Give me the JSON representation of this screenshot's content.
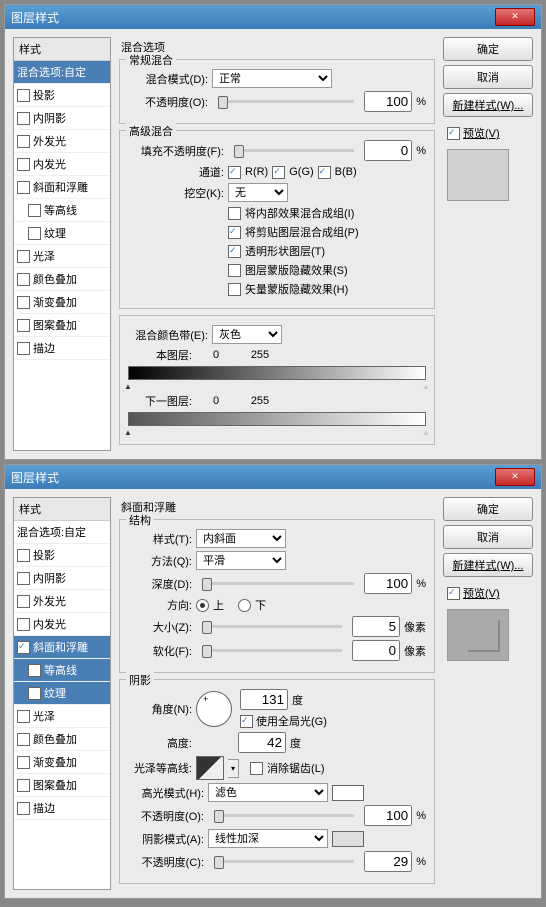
{
  "dialogs": [
    {
      "title": "图层样式",
      "styles_header": "样式",
      "styles": [
        {
          "label": "混合选项:自定",
          "chk": false,
          "sel": true
        },
        {
          "label": "投影",
          "chk": false
        },
        {
          "label": "内阴影",
          "chk": false
        },
        {
          "label": "外发光",
          "chk": false
        },
        {
          "label": "内发光",
          "chk": false
        },
        {
          "label": "斜面和浮雕",
          "chk": false
        },
        {
          "label": "等高线",
          "chk": false,
          "sub": true
        },
        {
          "label": "纹理",
          "chk": false,
          "sub": true
        },
        {
          "label": "光泽",
          "chk": false
        },
        {
          "label": "颜色叠加",
          "chk": false
        },
        {
          "label": "渐变叠加",
          "chk": false
        },
        {
          "label": "图案叠加",
          "chk": false
        },
        {
          "label": "描边",
          "chk": false
        }
      ],
      "section": "混合选项",
      "group1": "常规混合",
      "blend_mode_label": "混合模式(D):",
      "blend_mode": "正常",
      "opacity_label": "不透明度(O):",
      "opacity": "100",
      "pct": "%",
      "group2": "高级混合",
      "fill_label": "填充不透明度(F):",
      "fill": "0",
      "channels_label": "通道:",
      "ch_r": "R(R)",
      "ch_g": "G(G)",
      "ch_b": "B(B)",
      "knockout_label": "挖空(K):",
      "knockout": "无",
      "opt1": "将内部效果混合成组(I)",
      "opt2": "将剪贴图层混合成组(P)",
      "opt3": "透明形状图层(T)",
      "opt4": "图层蒙版隐藏效果(S)",
      "opt5": "矢量蒙版隐藏效果(H)",
      "blendif_label": "混合颜色带(E):",
      "blendif": "灰色",
      "this_layer": "本图层:",
      "v0": "0",
      "v255": "255",
      "under_layer": "下一图层:",
      "ok": "确定",
      "cancel": "取消",
      "newstyle": "新建样式(W)...",
      "preview": "预览(V)"
    },
    {
      "title": "图层样式",
      "styles_header": "样式",
      "styles": [
        {
          "label": "混合选项:自定",
          "chk": false
        },
        {
          "label": "投影",
          "chk": false
        },
        {
          "label": "内阴影",
          "chk": false
        },
        {
          "label": "外发光",
          "chk": false
        },
        {
          "label": "内发光",
          "chk": false
        },
        {
          "label": "斜面和浮雕",
          "chk": true,
          "sel": true
        },
        {
          "label": "等高线",
          "chk": false,
          "sub": true,
          "sel": true
        },
        {
          "label": "纹理",
          "chk": false,
          "sub": true,
          "sel": true
        },
        {
          "label": "光泽",
          "chk": false
        },
        {
          "label": "颜色叠加",
          "chk": false
        },
        {
          "label": "渐变叠加",
          "chk": false
        },
        {
          "label": "图案叠加",
          "chk": false
        },
        {
          "label": "描边",
          "chk": false
        }
      ],
      "section": "斜面和浮雕",
      "group1": "结构",
      "style_label": "样式(T):",
      "style": "内斜面",
      "technique_label": "方法(Q):",
      "technique": "平滑",
      "depth_label": "深度(D):",
      "depth": "100",
      "pct": "%",
      "dir_label": "方向:",
      "up": "上",
      "down": "下",
      "size_label": "大小(Z):",
      "size": "5",
      "px": "像素",
      "soften_label": "软化(F):",
      "soften": "0",
      "group2": "阴影",
      "angle_label": "角度(N):",
      "angle": "131",
      "deg": "度",
      "global": "使用全局光(G)",
      "altitude_label": "高度:",
      "altitude": "42",
      "gloss_label": "光泽等高线:",
      "anti": "消除锯齿(L)",
      "hmode_label": "高光模式(H):",
      "hmode": "滤色",
      "hop_label": "不透明度(O):",
      "hop": "100",
      "smode_label": "阴影模式(A):",
      "smode": "线性加深",
      "sop_label": "不透明度(C):",
      "sop": "29",
      "ok": "确定",
      "cancel": "取消",
      "newstyle": "新建样式(W)...",
      "preview": "预览(V)"
    }
  ]
}
